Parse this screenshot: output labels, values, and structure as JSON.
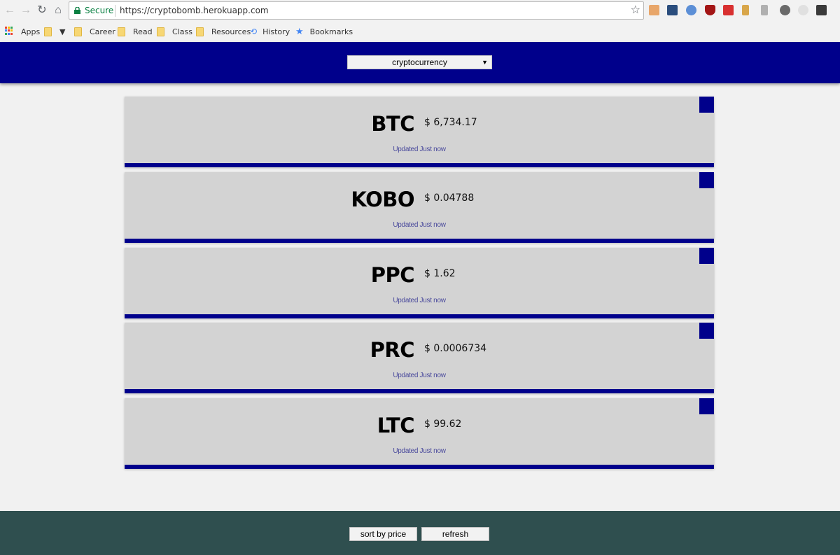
{
  "browser": {
    "secure_label": "Secure",
    "url": "https://cryptobomb.herokuapp.com"
  },
  "bookmarks": [
    {
      "label": "Apps",
      "icon": "apps-grid-icon"
    },
    {
      "label": "▼",
      "icon": "folder-icon"
    },
    {
      "label": "Career",
      "icon": "folder-icon"
    },
    {
      "label": "Read",
      "icon": "folder-icon"
    },
    {
      "label": "Class",
      "icon": "folder-icon"
    },
    {
      "label": "Resources",
      "icon": "folder-icon"
    },
    {
      "label": "History",
      "icon": "history-icon"
    },
    {
      "label": "Bookmarks",
      "icon": "star-icon"
    }
  ],
  "header": {
    "select_value": "cryptocurrency"
  },
  "cards": [
    {
      "symbol": "BTC",
      "price": "$ 6,734.17",
      "updated": "Updated Just now"
    },
    {
      "symbol": "KOBO",
      "price": "$ 0.04788",
      "updated": "Updated Just now"
    },
    {
      "symbol": "PPC",
      "price": "$ 1.62",
      "updated": "Updated Just now"
    },
    {
      "symbol": "PRC",
      "price": "$ 0.0006734",
      "updated": "Updated Just now"
    },
    {
      "symbol": "LTC",
      "price": "$ 99.62",
      "updated": "Updated Just now"
    }
  ],
  "footer": {
    "sort_label": "sort by price",
    "refresh_label": "refresh"
  },
  "colors": {
    "header_bg": "#00008b",
    "card_bg": "#d3d3d3",
    "footer_bg": "#2f4f4f",
    "secure_green": "#0b8043"
  }
}
